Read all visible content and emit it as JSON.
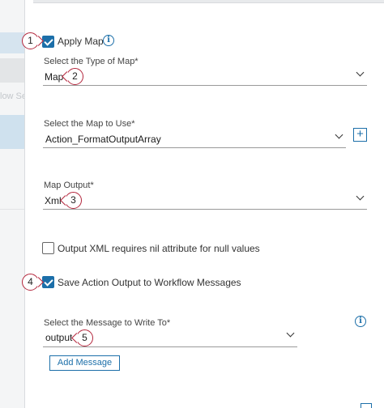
{
  "background": {
    "ghost_text": "low Se"
  },
  "apply_map": {
    "label": "Apply Map",
    "checked": true,
    "callout": "1"
  },
  "map_type": {
    "label": "Select the Type of Map*",
    "value": "Map",
    "callout": "2"
  },
  "map_to_use": {
    "label": "Select the Map to Use*",
    "value": "Action_FormatOutputArray",
    "add_label": "+"
  },
  "map_output": {
    "label": "Map Output*",
    "value": "Xml",
    "callout": "3"
  },
  "nil_attr": {
    "label": "Output XML requires nil attribute for null values",
    "checked": false
  },
  "save_output": {
    "label": "Save Action Output to Workflow Messages",
    "checked": true,
    "callout": "4"
  },
  "message": {
    "label": "Select the Message to Write To*",
    "value": "output",
    "callout": "5"
  },
  "add_message": {
    "label": "Add Message"
  },
  "icons": {
    "info": "i"
  },
  "colors": {
    "accent": "#1c6fa9",
    "callout_border": "#b3263c",
    "selected_band": "#cfe1ee"
  }
}
